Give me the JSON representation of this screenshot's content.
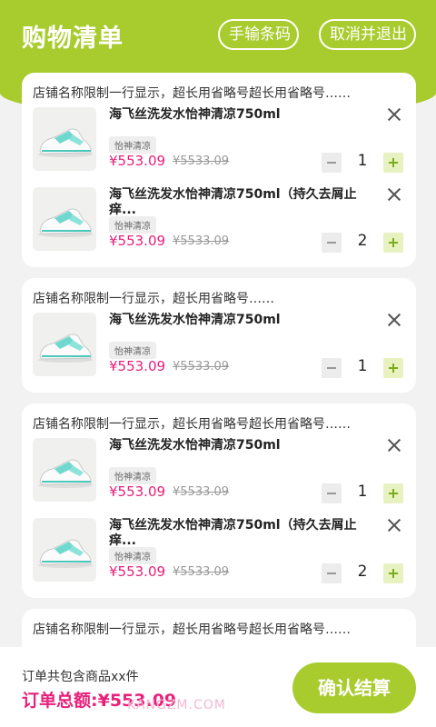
{
  "header": {
    "title": "购物清单",
    "manual_button": "手输条码",
    "cancel_button": "取消并退出"
  },
  "shops": [
    {
      "name": "店铺名称限制一行显示，超长用省略号超长用省略号……",
      "items": [
        {
          "title": "海飞丝洗发水怡神清凉750ml",
          "tag": "怡神清凉",
          "price": "¥553.09",
          "original_price": "¥5533.09",
          "quantity": "1"
        },
        {
          "title": "海飞丝洗发水怡神清凉750ml（持久去屑止痒...",
          "tag": "怡神清凉",
          "price": "¥553.09",
          "original_price": "¥5533.09",
          "quantity": "2"
        }
      ]
    },
    {
      "name": "店铺名称限制一行显示，超长用省略号……",
      "items": [
        {
          "title": "海飞丝洗发水怡神清凉750ml",
          "tag": "怡神清凉",
          "price": "¥553.09",
          "original_price": "¥5533.09",
          "quantity": "1"
        }
      ]
    },
    {
      "name": "店铺名称限制一行显示，超长用省略号超长用省略号……",
      "items": [
        {
          "title": "海飞丝洗发水怡神清凉750ml",
          "tag": "怡神清凉",
          "price": "¥553.09",
          "original_price": "¥5533.09",
          "quantity": "1"
        },
        {
          "title": "海飞丝洗发水怡神清凉750ml（持久去屑止痒...",
          "tag": "怡神清凉",
          "price": "¥553.09",
          "original_price": "¥5533.09",
          "quantity": "2"
        }
      ]
    },
    {
      "name": "店铺名称限制一行显示，超长用省略号超长用省略号……",
      "items": []
    }
  ],
  "footer": {
    "summary": "订单共包含商品xx件",
    "total": "订单总额:¥553.09",
    "confirm_button": "确认结算",
    "watermark": "KANGZM.COM"
  },
  "colors": {
    "brand_green": "#a8cc2e",
    "price_pink": "#e8207b"
  },
  "icons": {
    "remove": "close-icon",
    "decrease": "minus-icon",
    "increase": "plus-icon"
  }
}
